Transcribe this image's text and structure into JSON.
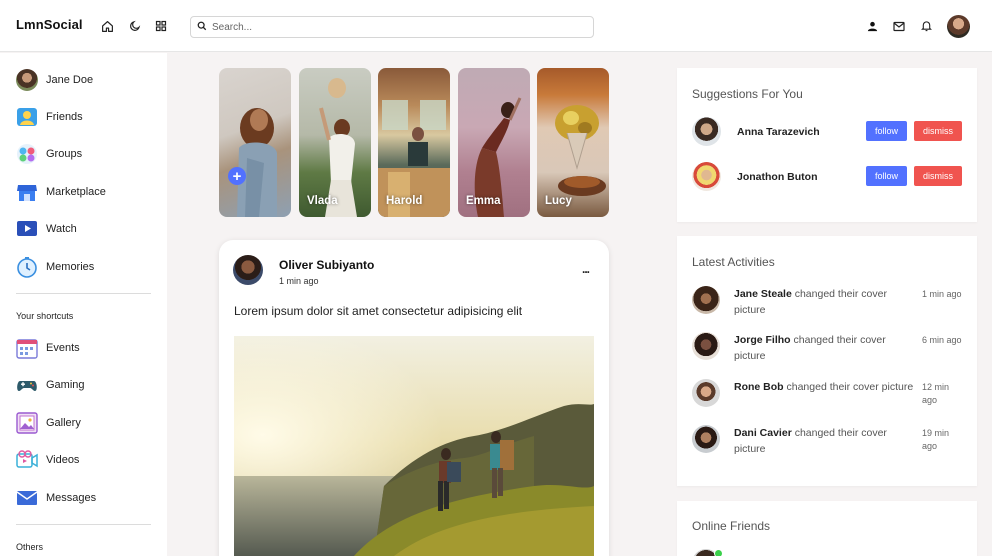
{
  "app": {
    "logo": "LmnSocial"
  },
  "navbar": {
    "search_placeholder": "Search...",
    "icons": [
      "home-icon",
      "moon-icon",
      "grid-icon",
      "search-icon",
      "user-icon",
      "mail-icon",
      "bell-icon"
    ]
  },
  "sidebar": {
    "profile_name": "Jane Doe",
    "main_items": [
      {
        "label": "Friends",
        "icon": "friends-icon"
      },
      {
        "label": "Groups",
        "icon": "groups-icon"
      },
      {
        "label": "Marketplace",
        "icon": "marketplace-icon"
      },
      {
        "label": "Watch",
        "icon": "watch-icon"
      },
      {
        "label": "Memories",
        "icon": "memories-icon"
      }
    ],
    "shortcuts_title": "Your shortcuts",
    "shortcut_items": [
      {
        "label": "Events",
        "icon": "events-icon"
      },
      {
        "label": "Gaming",
        "icon": "gaming-icon"
      },
      {
        "label": "Gallery",
        "icon": "gallery-icon"
      },
      {
        "label": "Videos",
        "icon": "videos-icon"
      },
      {
        "label": "Messages",
        "icon": "messages-icon"
      }
    ],
    "others_title": "Others"
  },
  "stories": [
    {
      "name": ""
    },
    {
      "name": "Vlada"
    },
    {
      "name": "Harold"
    },
    {
      "name": "Emma"
    },
    {
      "name": "Lucy"
    }
  ],
  "post": {
    "author": "Oliver Subiyanto",
    "time": "1 min ago",
    "text": "Lorem ipsum dolor sit amet consectetur adipisicing elit",
    "more": "..."
  },
  "suggestions": {
    "title": "Suggestions For You",
    "follow_label": "follow",
    "dismiss_label": "dismiss",
    "people": [
      {
        "name": "Anna Tarazevich"
      },
      {
        "name": "Jonathon Buton"
      }
    ]
  },
  "activities": {
    "title": "Latest Activities",
    "items": [
      {
        "name": "Jane Steale",
        "action": "changed their cover picture",
        "time": "1 min ago"
      },
      {
        "name": "Jorge Filho",
        "action": "changed their cover picture",
        "time": "6 min ago"
      },
      {
        "name": "Rone Bob",
        "action": "changed their cover picture",
        "time": "12 min ago"
      },
      {
        "name": "Dani Cavier",
        "action": "changed their cover picture",
        "time": "19 min ago"
      }
    ]
  },
  "online_friends": {
    "title": "Online Friends"
  },
  "colors": {
    "accent": "#5271ff",
    "danger": "#f0544f",
    "background": "#f6f3f3"
  }
}
